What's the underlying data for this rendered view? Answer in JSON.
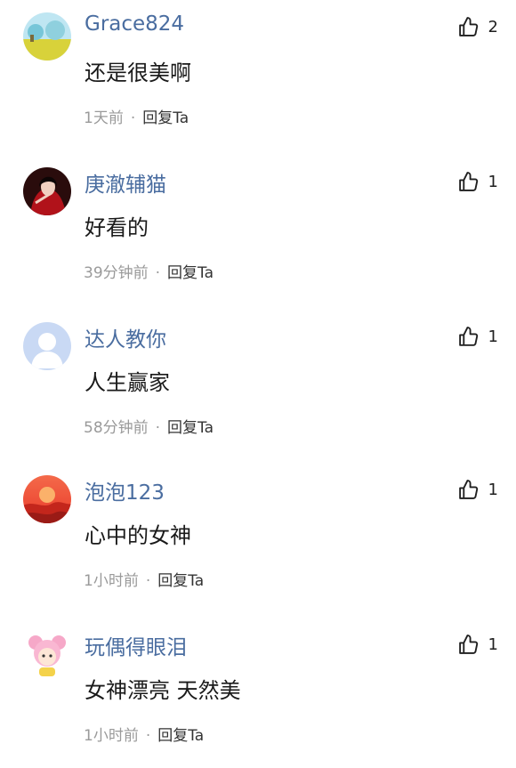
{
  "comments": [
    {
      "username": "Grace824",
      "text": "还是很美啊",
      "time": "1天前",
      "reply": "回复Ta",
      "likes": "2",
      "avatar": "landscape-avatar"
    },
    {
      "username": "庚澈辅猫",
      "text": "好看的",
      "time": "39分钟前",
      "reply": "回复Ta",
      "likes": "1",
      "avatar": "portrait-avatar"
    },
    {
      "username": "达人教你",
      "text": "人生赢家",
      "time": "58分钟前",
      "reply": "回复Ta",
      "likes": "1",
      "avatar": "default-avatar"
    },
    {
      "username": "泡泡123",
      "text": "心中的女神",
      "time": "1小时前",
      "reply": "回复Ta",
      "likes": "1",
      "avatar": "sunset-avatar"
    },
    {
      "username": "玩偶得眼泪",
      "text": "女神漂亮 天然美",
      "time": "1小时前",
      "reply": "回复Ta",
      "likes": "1",
      "avatar": "cartoon-avatar"
    }
  ],
  "separator": "·",
  "colors": {
    "username": "#4a6da0",
    "meta": "#9a9a9a",
    "text": "#1a1a1a"
  }
}
